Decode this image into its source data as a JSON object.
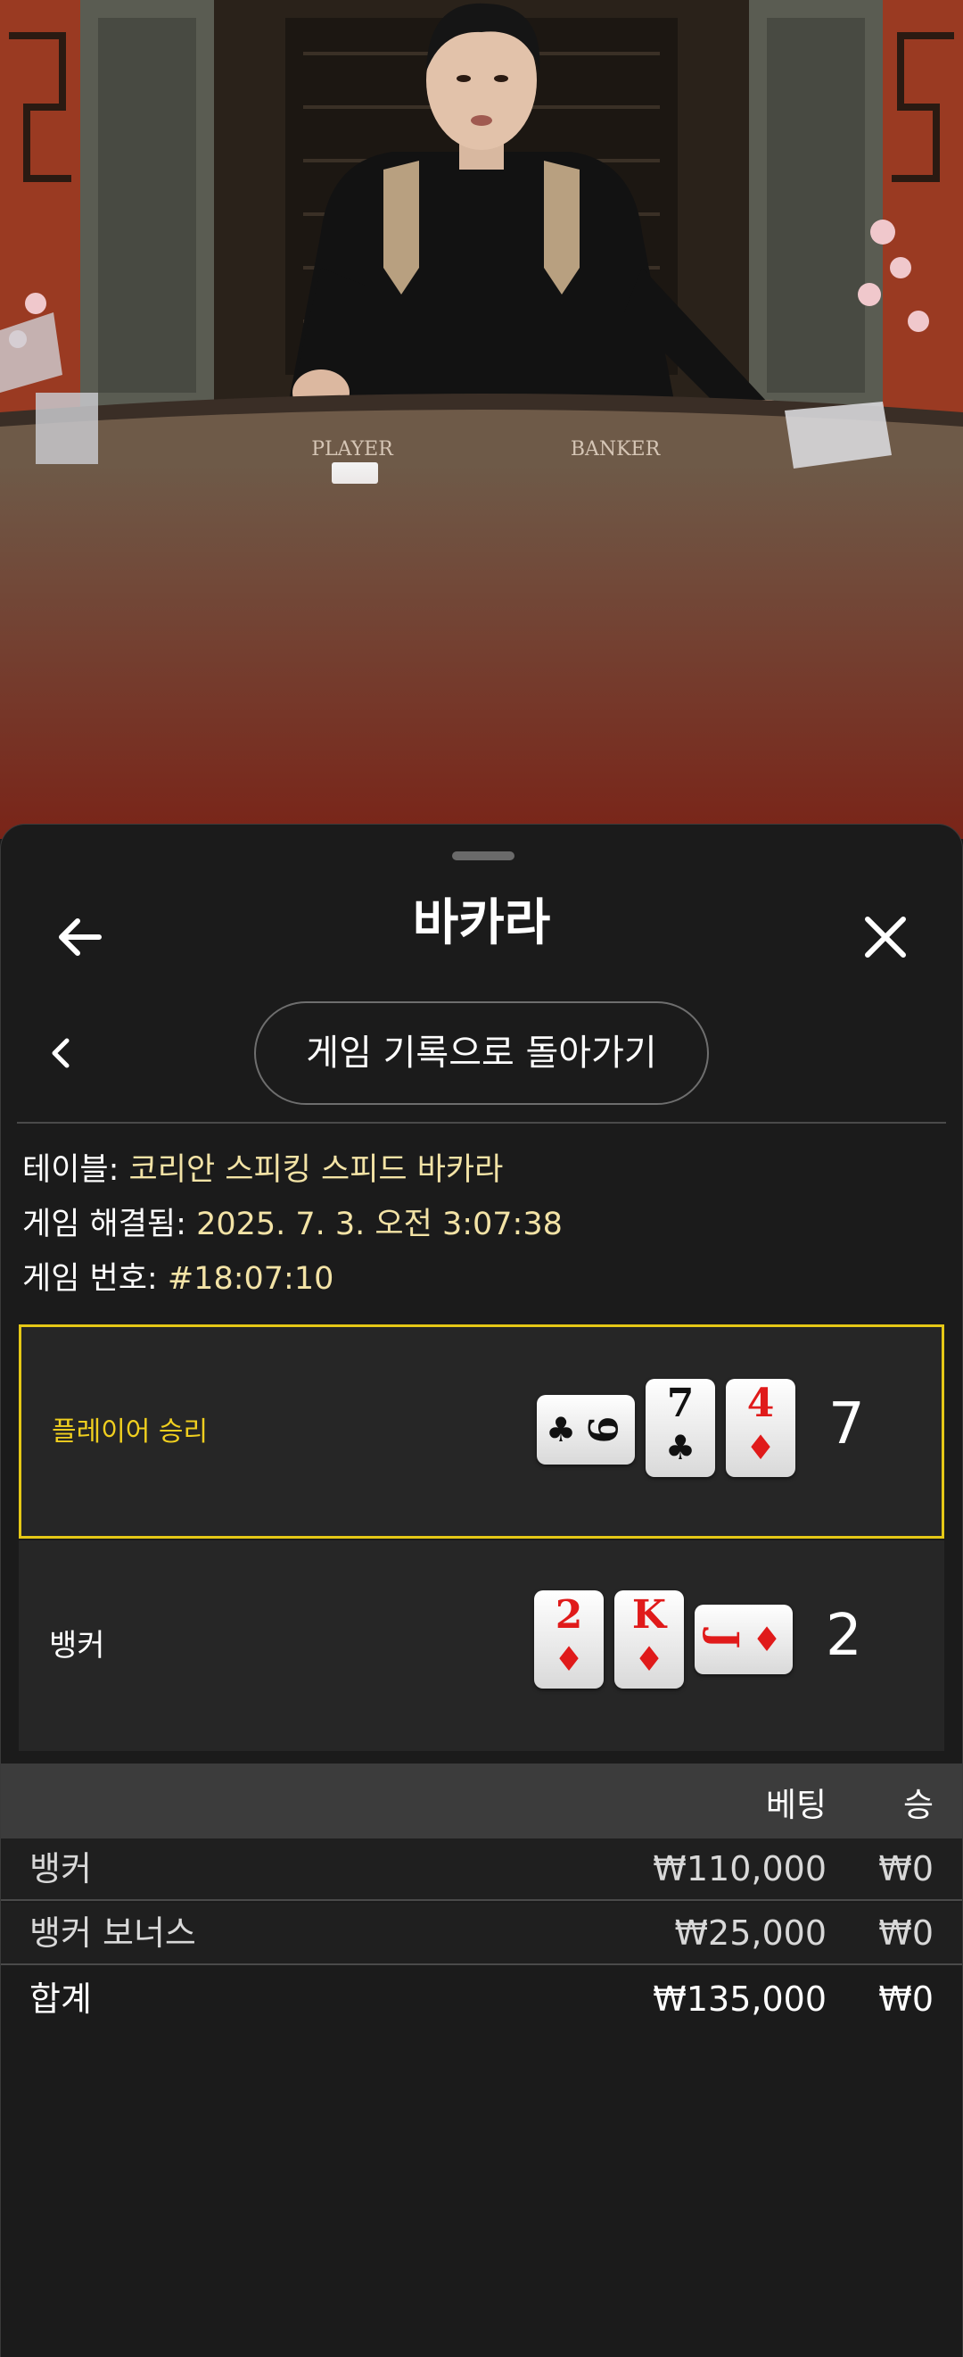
{
  "video": {
    "table_labels": {
      "player": "PLAYER",
      "banker": "BANKER"
    }
  },
  "sheet": {
    "title": "바카라",
    "back_to_history": "게임 기록으로 돌아가기",
    "info": {
      "table_label": "테이블:",
      "table_value": "코리안 스피킹 스피드 바카라",
      "resolved_label": "게임 해결됨:",
      "resolved_value": "2025. 7. 3. 오전 3:07:38",
      "game_no_label": "게임 번호:",
      "game_no_value": "#18:07:10"
    },
    "results": {
      "player": {
        "label": "플레이어 승리",
        "score": "7",
        "highlight_color": "#e5c816",
        "cards": [
          {
            "rank": "9",
            "suit": "♣",
            "color": "black",
            "orientation": "sideways"
          },
          {
            "rank": "7",
            "suit": "♣",
            "color": "black",
            "orientation": "upright"
          },
          {
            "rank": "4",
            "suit": "♦",
            "color": "red",
            "orientation": "upright"
          }
        ]
      },
      "banker": {
        "label": "뱅커",
        "score": "2",
        "cards": [
          {
            "rank": "2",
            "suit": "♦",
            "color": "red",
            "orientation": "upright"
          },
          {
            "rank": "K",
            "suit": "♦",
            "color": "red",
            "orientation": "upright"
          },
          {
            "rank": "J",
            "suit": "♦",
            "color": "red",
            "orientation": "sideways"
          }
        ]
      }
    },
    "bets": {
      "columns": {
        "bet": "베팅",
        "win": "승"
      },
      "rows": [
        {
          "name": "뱅커",
          "bet": "₩110,000",
          "win": "₩0"
        },
        {
          "name": "뱅커 보너스",
          "bet": "₩25,000",
          "win": "₩0"
        }
      ],
      "total": {
        "name": "합계",
        "bet": "₩135,000",
        "win": "₩0"
      }
    }
  },
  "icons": {
    "back": "arrow-left-icon",
    "close": "close-x-icon",
    "nav_back": "chevron-left-icon"
  }
}
